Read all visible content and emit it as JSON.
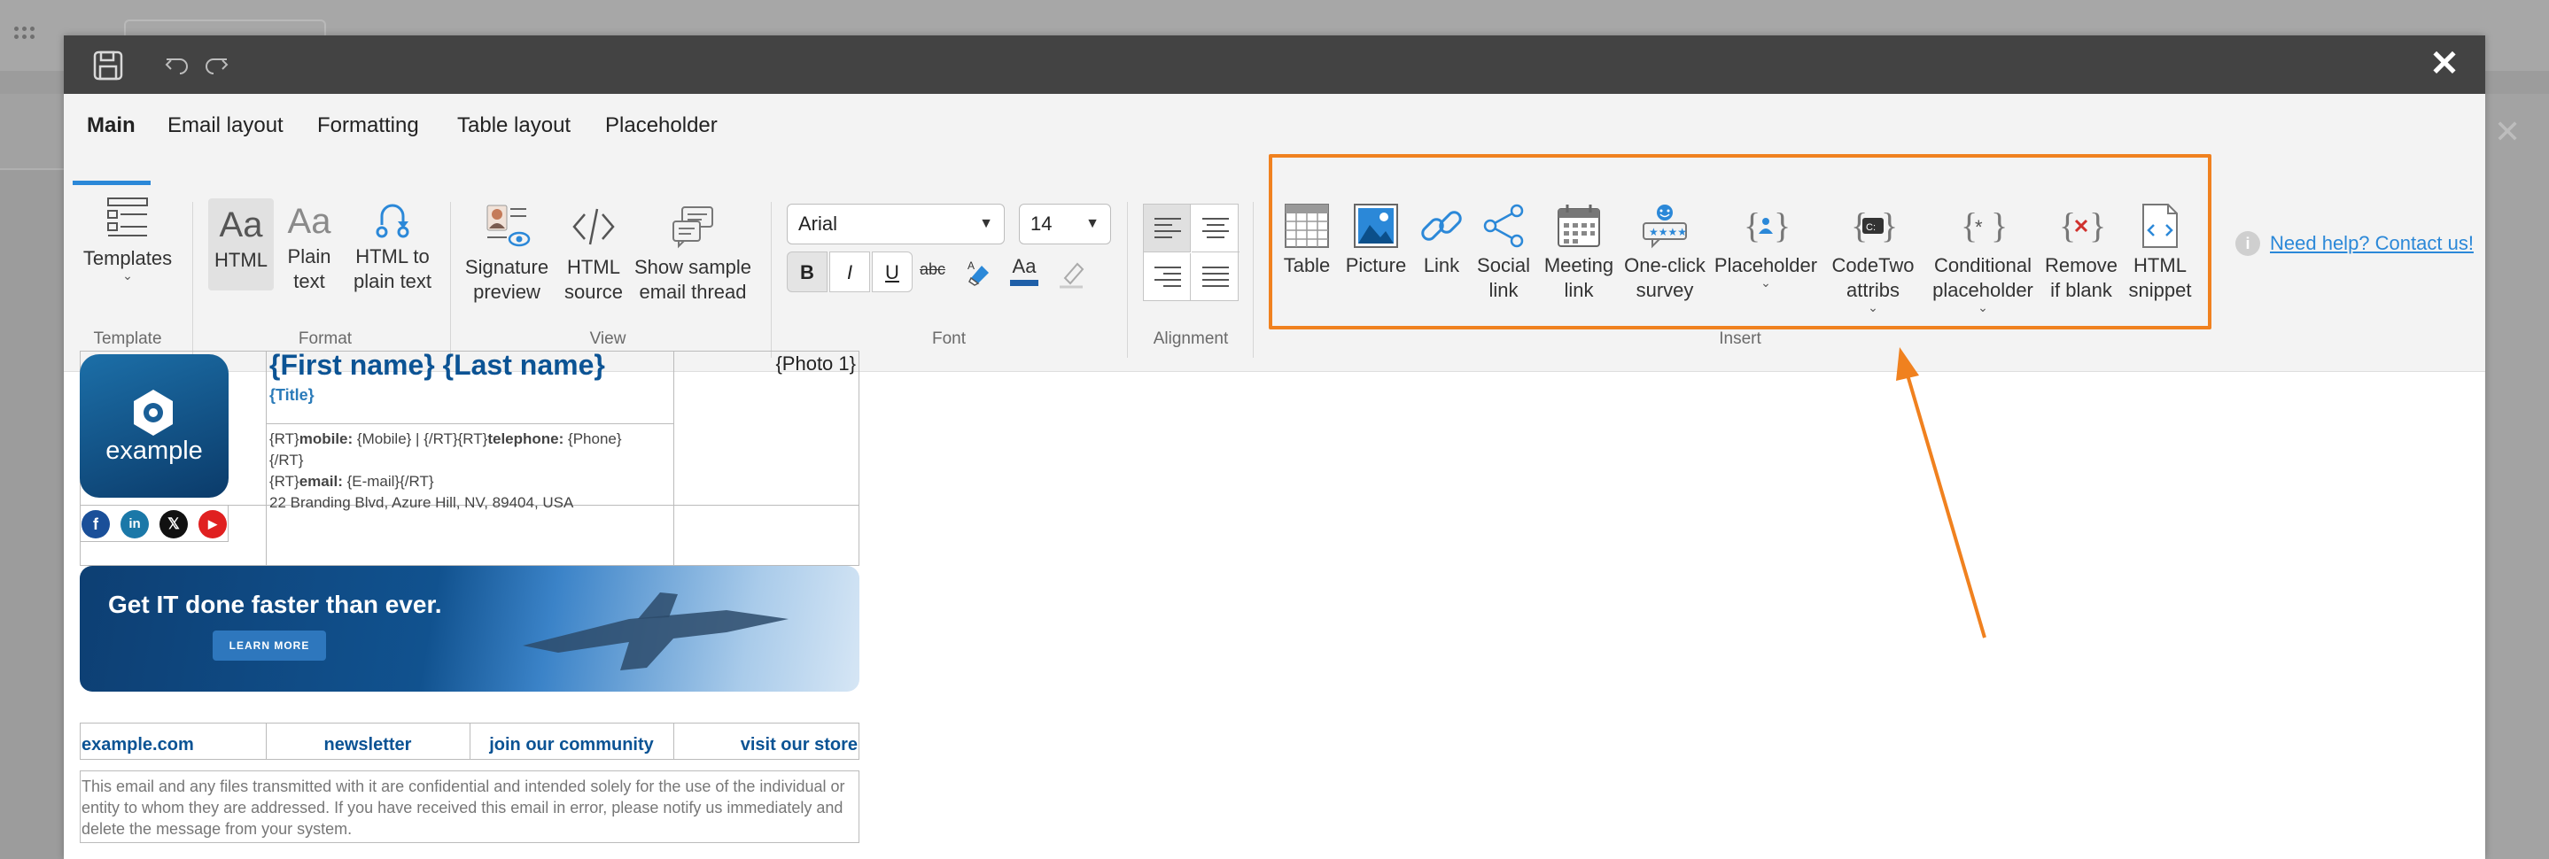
{
  "titlebar": {
    "save_icon": "floppy-disk-icon",
    "undo_icon": "undo-icon",
    "redo_icon": "redo-icon",
    "close": "✕"
  },
  "tabs": [
    "Main",
    "Email layout",
    "Formatting",
    "Table layout",
    "Placeholder"
  ],
  "ribbon": {
    "template": {
      "button": "Templates",
      "group": "Template"
    },
    "format": {
      "html": "HTML",
      "plain_1": "Plain",
      "plain_2": "text",
      "html_to_1": "HTML to",
      "html_to_2": "plain text",
      "group": "Format"
    },
    "view": {
      "sig_1": "Signature",
      "sig_2": "preview",
      "src_1": "HTML",
      "src_2": "source",
      "thread_1": "Show sample",
      "thread_2": "email thread",
      "group": "View"
    },
    "font": {
      "family": "Arial",
      "size": "14",
      "bold": "B",
      "italic": "I",
      "underline": "U",
      "strike": "abc",
      "group": "Font",
      "font_color": "#1f5fa8"
    },
    "alignment": {
      "group": "Alignment"
    },
    "insert": {
      "group": "Insert",
      "table": "Table",
      "picture": "Picture",
      "link": "Link",
      "social_1": "Social",
      "social_2": "link",
      "meeting_1": "Meeting",
      "meeting_2": "link",
      "survey_1": "One-click",
      "survey_2": "survey",
      "placeholder": "Placeholder",
      "codetwo_1": "CodeTwo",
      "codetwo_2": "attribs",
      "conditional_1": "Conditional",
      "conditional_2": "placeholder",
      "remove_1": "Remove",
      "remove_2": "if blank",
      "snippet_1": "HTML",
      "snippet_2": "snippet"
    },
    "help": "Need help? Contact us!",
    "highlight_color": "#f0811f"
  },
  "signature": {
    "logo_text": "example",
    "name": "{First name} {Last name}",
    "title": "{Title}",
    "photo": "{Photo 1}",
    "contact_line1_a": "{RT}",
    "contact_line1_mobile_label": "mobile:",
    "contact_line1_mobile": " {Mobile}  |  {/RT}{RT}",
    "contact_line1_tel_label": "telephone:",
    "contact_line1_tel": " {Phone}",
    "contact_line2": "{/RT}",
    "contact_line3_a": "{RT}",
    "contact_line3_email_label": "email:",
    "contact_line3_email": " {E-mail}{/RT}",
    "address": "22 Branding Blvd, Azure Hill, NV, 89404, USA",
    "banner_text_1": "Get ",
    "banner_text_bold": "IT",
    "banner_text_2": " done faster than ever.",
    "banner_button": "LEARN MORE",
    "links": [
      "example.com",
      "newsletter",
      "join our community",
      "visit our store"
    ],
    "disclaimer": "This email and any files transmitted with it are confidential and intended solely for the use of the individual or entity to whom they are addressed. If you have received this email in error, please notify us immediately and delete the message from your system."
  }
}
